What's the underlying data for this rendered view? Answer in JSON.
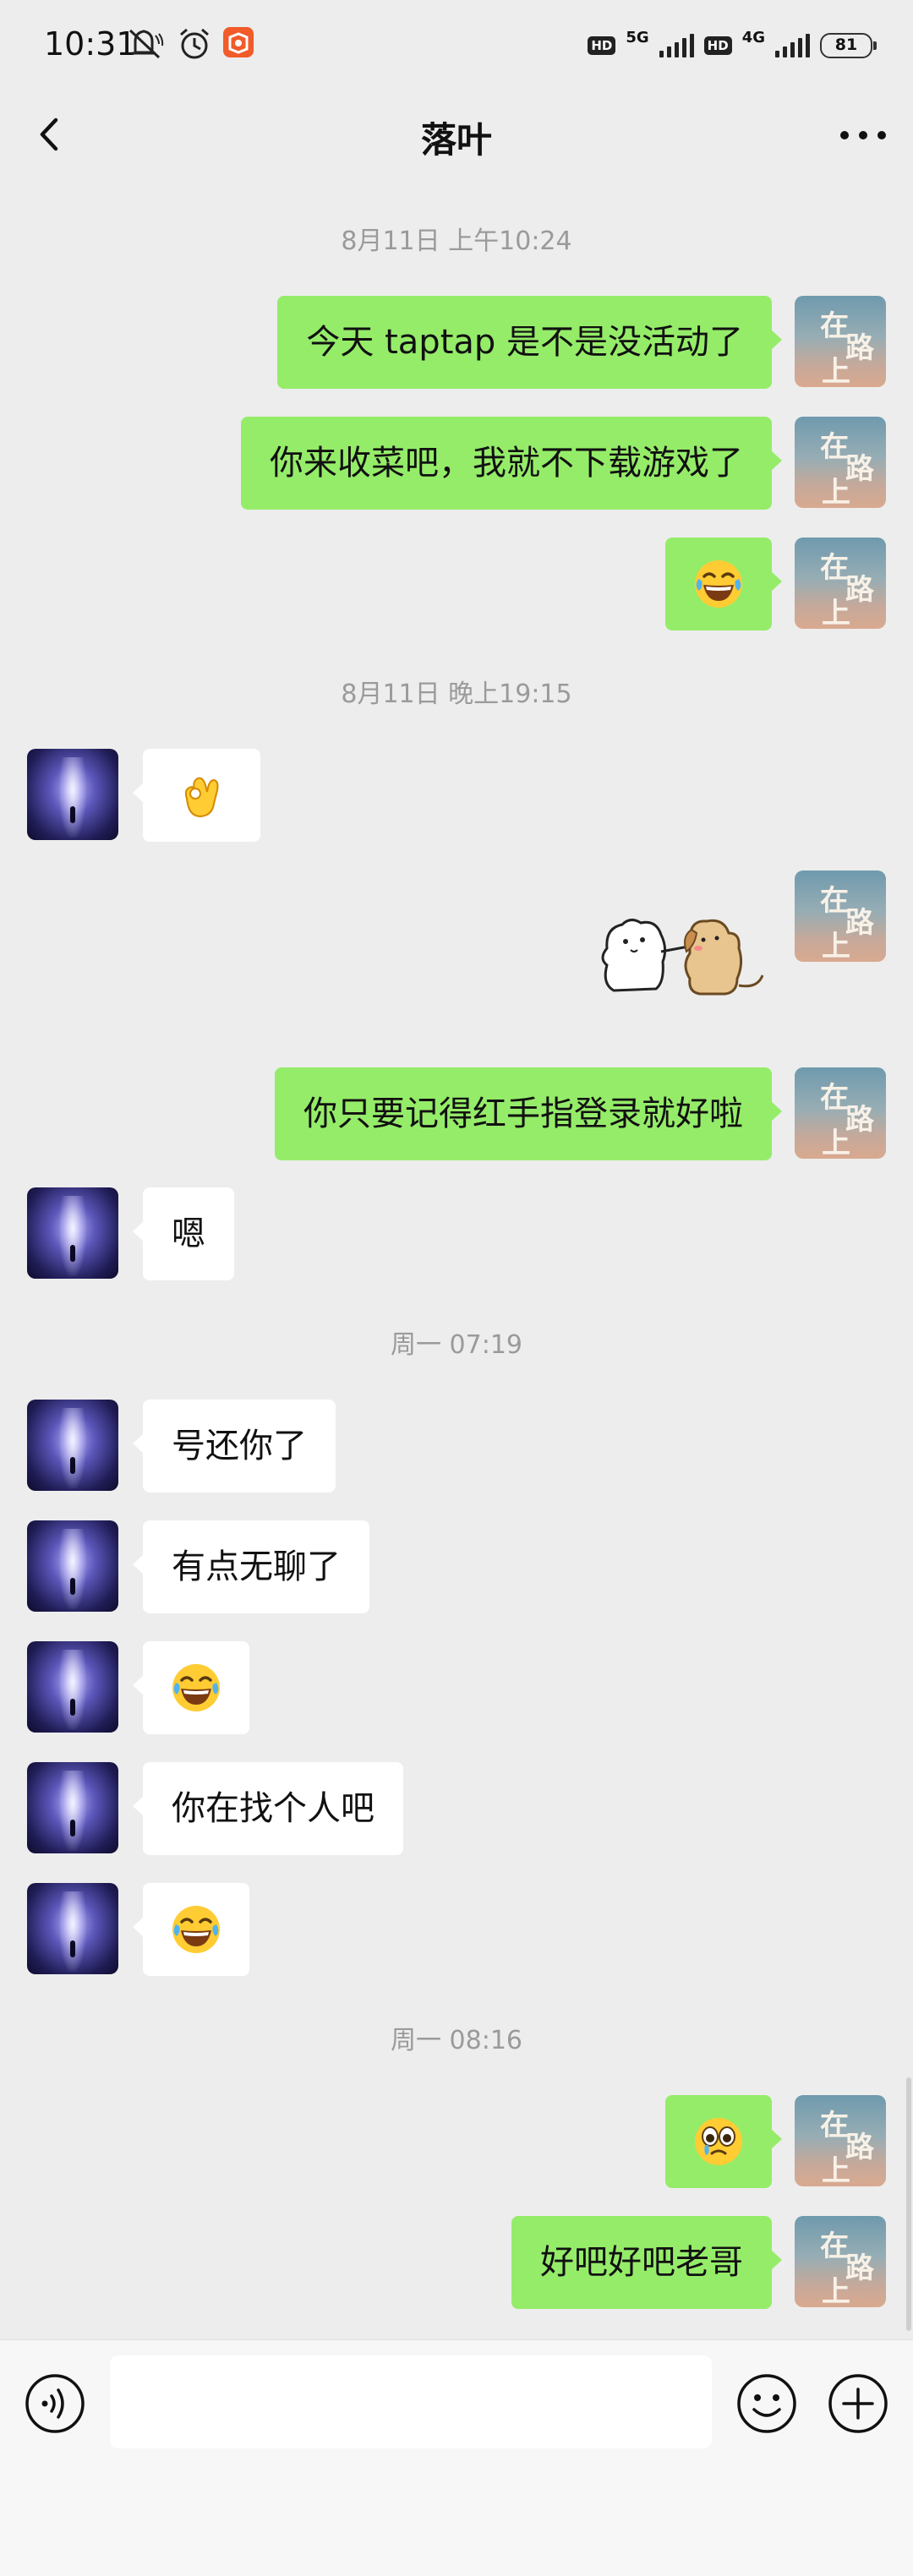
{
  "status_bar": {
    "time": "10:31",
    "hd1": "HD",
    "net1": "5G",
    "hd2": "HD",
    "net2": "4G",
    "battery": "81",
    "icons": [
      "mute-icon",
      "alarm-icon",
      "app-notification-icon",
      "signal-icon",
      "battery-icon"
    ]
  },
  "header": {
    "title": "落叶",
    "back_icon": "chevron-left-icon",
    "more_icon": "more-dots-icon"
  },
  "timestamps": [
    "8月11日 上午10:24",
    "8月11日 晚上19:15",
    "周一 07:19",
    "周一 08:16"
  ],
  "messages": [
    {
      "from": "self",
      "text": "今天 taptap 是不是没活动了"
    },
    {
      "from": "self",
      "text": "你来收菜吧，我就不下载游戏了"
    },
    {
      "from": "self",
      "emoji": "laughing-tears-emoji"
    },
    {
      "from": "other",
      "emoji": "ok-hand-emoji"
    },
    {
      "from": "self",
      "sticker": "dogs-sticker"
    },
    {
      "from": "self",
      "text": "你只要记得红手指登录就好啦"
    },
    {
      "from": "other",
      "text": "嗯"
    },
    {
      "from": "other",
      "text": "号还你了"
    },
    {
      "from": "other",
      "text": "有点无聊了"
    },
    {
      "from": "other",
      "emoji": "laughing-tears-emoji"
    },
    {
      "from": "other",
      "text": "你在找个人吧"
    },
    {
      "from": "other",
      "emoji": "laughing-tears-emoji"
    },
    {
      "from": "self",
      "emoji": "teary-eyed-emoji"
    },
    {
      "from": "self",
      "text": "好吧好吧老哥"
    }
  ],
  "avatar_self_text": [
    "在",
    "路",
    "上"
  ],
  "input_bar": {
    "placeholder": "",
    "icons": [
      "voice-icon",
      "emoji-icon",
      "plus-icon"
    ]
  },
  "colors": {
    "background": "#ededed",
    "bubble_self": "#95ec69",
    "bubble_other": "#ffffff",
    "timestamp": "#9a9a9a"
  }
}
